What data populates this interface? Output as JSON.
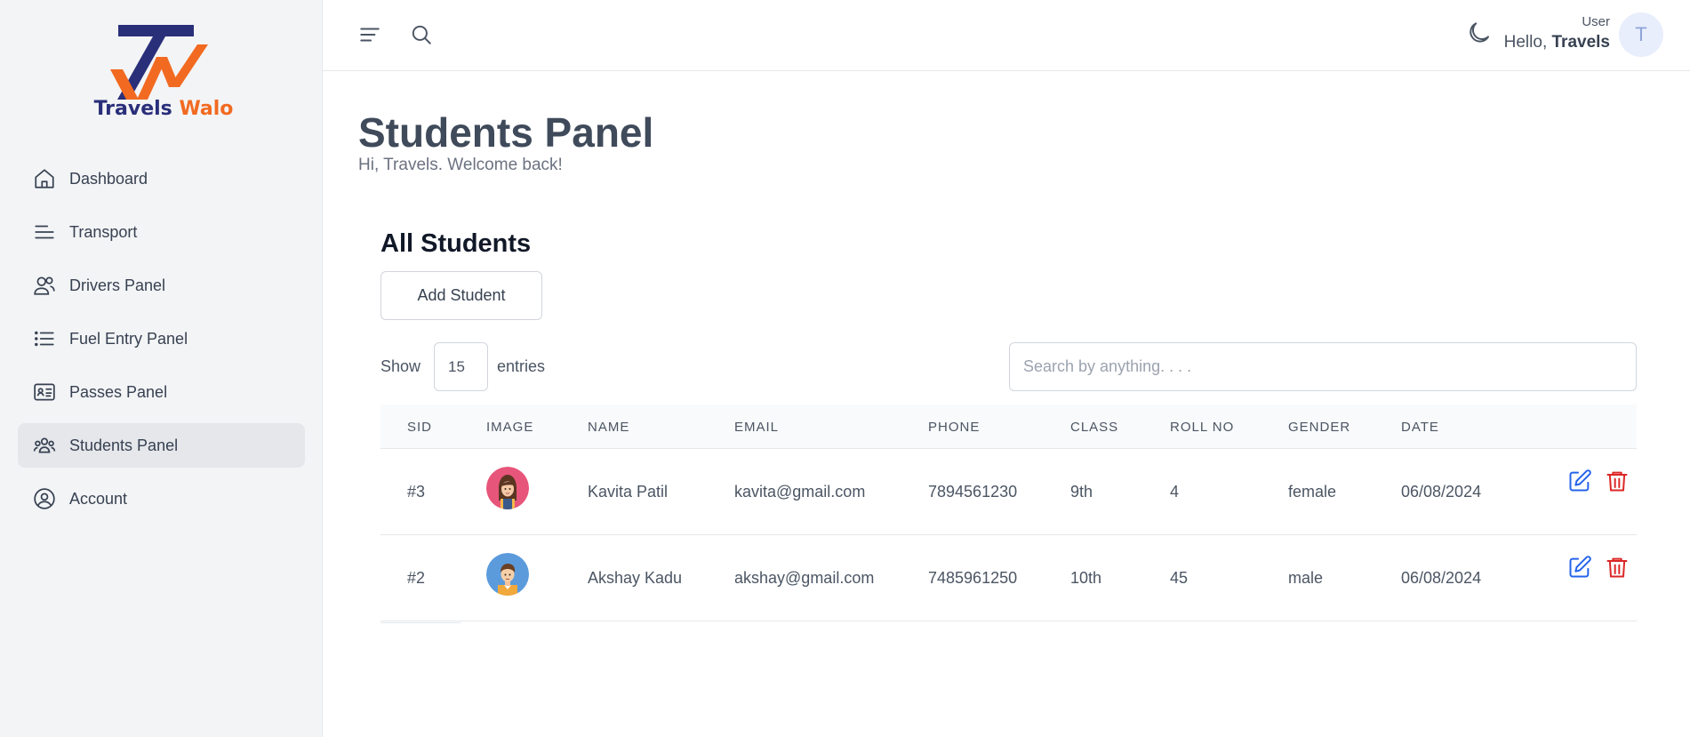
{
  "brand": {
    "name_part1": "Travels",
    "name_part2": "Walo",
    "color_primary": "#2a2f7a",
    "color_accent": "#f26a21"
  },
  "sidebar": {
    "items": [
      {
        "label": "Dashboard",
        "icon": "home-icon"
      },
      {
        "label": "Transport",
        "icon": "lines-icon"
      },
      {
        "label": "Drivers Panel",
        "icon": "users-icon"
      },
      {
        "label": "Fuel Entry Panel",
        "icon": "list-icon"
      },
      {
        "label": "Passes Panel",
        "icon": "id-card-icon"
      },
      {
        "label": "Students Panel",
        "icon": "group-icon",
        "active": true
      },
      {
        "label": "Account",
        "icon": "user-circle-icon"
      }
    ]
  },
  "topbar": {
    "user_role": "User",
    "greeting": "Hello,",
    "user_name": "Travels",
    "avatar_initial": "T"
  },
  "page": {
    "title": "Students Panel",
    "subtitle": "Hi, Travels. Welcome back!"
  },
  "students": {
    "section_title": "All Students",
    "add_button": "Add Student",
    "show_label": "Show",
    "entries_value": "15",
    "entries_label": "entries",
    "search_placeholder": "Search by anything. . . .",
    "columns": [
      "SID",
      "IMAGE",
      "NAME",
      "EMAIL",
      "PHONE",
      "CLASS",
      "ROLL NO",
      "GENDER",
      "DATE"
    ],
    "rows": [
      {
        "sid": "#3",
        "avatar": "female-avatar",
        "name": "Kavita Patil",
        "email": "kavita@gmail.com",
        "phone": "7894561230",
        "class": "9th",
        "roll": "4",
        "gender": "female",
        "date": "06/08/2024"
      },
      {
        "sid": "#2",
        "avatar": "male-avatar",
        "name": "Akshay Kadu",
        "email": "akshay@gmail.com",
        "phone": "7485961250",
        "class": "10th",
        "roll": "45",
        "gender": "male",
        "date": "06/08/2024"
      }
    ]
  },
  "colors": {
    "edit": "#2563eb",
    "delete": "#dc2626",
    "active_nav": "#e5e7eb"
  }
}
